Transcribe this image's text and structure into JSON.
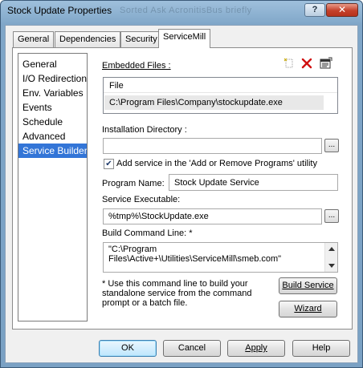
{
  "window": {
    "title": "Stock Update Properties",
    "title_ghost": "Sorted   Ask   AcronitisBus   briefly"
  },
  "titlebar_buttons": {
    "help": "?",
    "close": "✕"
  },
  "tabs": [
    {
      "label": "General"
    },
    {
      "label": "Dependencies"
    },
    {
      "label": "Security"
    },
    {
      "label": "ServiceMill"
    }
  ],
  "nav": [
    {
      "label": "General"
    },
    {
      "label": "I/O Redirection"
    },
    {
      "label": "Env. Variables"
    },
    {
      "label": "Events"
    },
    {
      "label": "Schedule"
    },
    {
      "label": "Advanced"
    },
    {
      "label": "Service Builder"
    }
  ],
  "embedded": {
    "label": "Embedded Files :",
    "column_header": "File",
    "files": [
      "C:\\Program Files\\Company\\stockupdate.exe"
    ],
    "icons": [
      "new-file-icon",
      "delete-icon",
      "properties-icon"
    ]
  },
  "install_dir": {
    "label": "Installation Directory :",
    "value": "",
    "browse": "..."
  },
  "add_remove": {
    "label": "Add service in the 'Add or Remove Programs' utility",
    "checked": true
  },
  "program_name": {
    "label": "Program Name:",
    "value": "Stock Update Service"
  },
  "service_exe": {
    "label": "Service Executable:",
    "value": "%tmp%\\StockUpdate.exe",
    "browse": "..."
  },
  "build_cmd": {
    "label": "Build Command Line: *",
    "line1": "\"C:\\Program",
    "line2": "Files\\Active+\\Utilities\\ServiceMill\\smeb.com\""
  },
  "note": {
    "line1": "* Use this command line to build your",
    "line2": "standalone service from the command",
    "line3": "prompt or a batch file."
  },
  "buttons": {
    "build_service": "Build Service",
    "wizard": "Wizard",
    "ok": "OK",
    "cancel": "Cancel",
    "apply": "Apply",
    "help": "Help"
  },
  "colors": {
    "selection": "#3375d7",
    "delete_icon": "#d01010"
  }
}
